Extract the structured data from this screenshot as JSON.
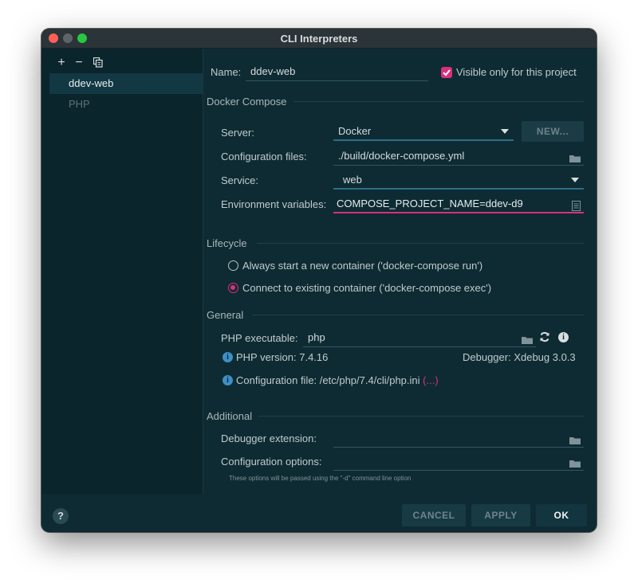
{
  "window": {
    "title": "CLI Interpreters"
  },
  "colors": {
    "accent": "#d9307d",
    "background": "#0e2b33",
    "info": "#3e8fc6"
  },
  "sidebar": {
    "toolbar": {
      "add": "+",
      "remove": "−",
      "copy": "copy-icon"
    },
    "items": [
      {
        "label": "ddev-web",
        "selected": true
      },
      {
        "label": "PHP",
        "selected": false
      }
    ]
  },
  "main": {
    "name_label": "Name:",
    "name_value": "ddev-web",
    "visible_only_label": "Visible only for this project",
    "visible_only_checked": true,
    "docker_compose": {
      "section": "Docker Compose",
      "server_label": "Server:",
      "server_value": "Docker",
      "new_button": "NEW...",
      "config_label": "Configuration files:",
      "config_value": "./build/docker-compose.yml",
      "service_label": "Service:",
      "service_value": "web",
      "env_label": "Environment variables:",
      "env_value": "COMPOSE_PROJECT_NAME=ddev-d9"
    },
    "lifecycle": {
      "section": "Lifecycle",
      "option_run": "Always start a new container ('docker-compose run')",
      "option_exec": "Connect to existing container ('docker-compose exec')",
      "selected": "exec"
    },
    "general": {
      "section": "General",
      "php_exec_label": "PHP executable:",
      "php_exec_value": "php",
      "php_version": "PHP version: 7.4.16",
      "debugger": "Debugger: Xdebug 3.0.3",
      "config_file": "Configuration file: /etc/php/7.4/cli/php.ini",
      "config_file_more": "(...)"
    },
    "additional": {
      "section": "Additional",
      "debugger_ext_label": "Debugger extension:",
      "debugger_ext_value": "",
      "config_options_label": "Configuration options:",
      "config_options_value": "",
      "hint": "These options will be passed using the \"-d\" command line option"
    }
  },
  "footer": {
    "help": "?",
    "cancel": "CANCEL",
    "apply": "APPLY",
    "ok": "OK"
  }
}
